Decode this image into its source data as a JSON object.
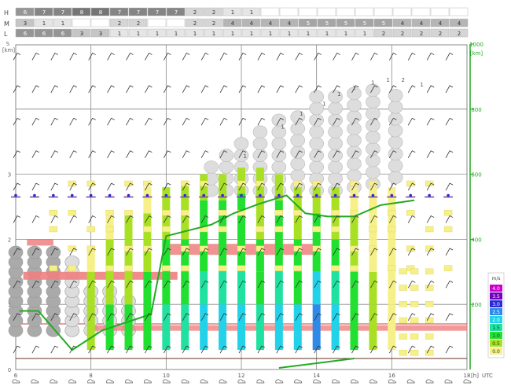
{
  "cloud_rows": [
    {
      "label": "H",
      "cells": [
        "6",
        "7",
        "7",
        "8",
        "8",
        "7",
        "7",
        "7",
        "7",
        "2",
        "2",
        "1",
        "1",
        "",
        "",
        "",
        "",
        "",
        "",
        "",
        "",
        "",
        "",
        ""
      ]
    },
    {
      "label": "M",
      "cells": [
        "3",
        "1",
        "1",
        "",
        "",
        "2",
        "2",
        "",
        "",
        "2",
        "2",
        "4",
        "4",
        "4",
        "4",
        "5",
        "5",
        "5",
        "5",
        "5",
        "4",
        "4",
        "4",
        "4"
      ]
    },
    {
      "label": "L",
      "cells": [
        "6",
        "6",
        "6",
        "3",
        "3",
        "1",
        "1",
        "1",
        "1",
        "1",
        "1",
        "1",
        "1",
        "1",
        "1",
        "1",
        "1",
        "1",
        "1",
        "2",
        "2",
        "2",
        "2",
        "2"
      ]
    }
  ],
  "chart_data": {
    "type": "heatmap",
    "x_unit": "UTC",
    "x_ticks": [
      "6",
      "8",
      "10",
      "12",
      "14",
      "16",
      "18"
    ],
    "x_tick_suffix": "[h]",
    "xlim": [
      6,
      18
    ],
    "y_left_label": "S",
    "y_left_unit": "[km]",
    "y_left_ticks": [
      "0",
      "1",
      "2",
      "3"
    ],
    "ylim_km": [
      0,
      5
    ],
    "y_right_unit": "[km]",
    "y_right_ticks": [
      "200",
      "400",
      "600",
      "800",
      "1000"
    ],
    "legend": {
      "unit": "m/s",
      "entries": [
        {
          "label": "4.0",
          "color": "#cc00cc"
        },
        {
          "label": "3.5",
          "color": "#7000c0"
        },
        {
          "label": "3.0",
          "color": "#2a2ad8"
        },
        {
          "label": "2.5",
          "color": "#2e8ae6"
        },
        {
          "label": "2.0",
          "color": "#22d2e8"
        },
        {
          "label": "1.5",
          "color": "#1fe2a0"
        },
        {
          "label": "1.0",
          "color": "#22e030"
        },
        {
          "label": "0.5",
          "color": "#a8e024"
        },
        {
          "label": "0.0",
          "color": "#f6f088"
        }
      ]
    },
    "boundary_layer_height_right_scale": [
      {
        "t": 6.1,
        "h": 180
      },
      {
        "t": 6.6,
        "h": 180
      },
      {
        "t": 7.2,
        "h": 100
      },
      {
        "t": 7.5,
        "h": 60
      },
      {
        "t": 8.3,
        "h": 120
      },
      {
        "t": 9.6,
        "h": 170
      },
      {
        "t": 10.0,
        "h": 410
      },
      {
        "t": 11.2,
        "h": 445
      },
      {
        "t": 11.8,
        "h": 480
      },
      {
        "t": 12.5,
        "h": 510
      },
      {
        "t": 13.2,
        "h": 535
      },
      {
        "t": 13.7,
        "h": 480
      },
      {
        "t": 14.3,
        "h": 470
      },
      {
        "t": 15.0,
        "h": 470
      },
      {
        "t": 15.7,
        "h": 505
      },
      {
        "t": 16.6,
        "h": 520
      }
    ],
    "cloud_counts": [
      "1",
      "1",
      "1",
      "1",
      "1",
      "1",
      "1",
      "1",
      "2",
      "1"
    ],
    "vertical_velocity_cells": [
      {
        "t": 8.0,
        "z": [
          0.3,
          1.0,
          1.5
        ],
        "v": [
          0.5,
          0.5,
          0.0
        ]
      },
      {
        "t": 8.5,
        "z": [
          0.3,
          1.0,
          1.5,
          2.0
        ],
        "v": [
          1.0,
          0.5,
          0.5,
          0.0
        ]
      },
      {
        "t": 9.0,
        "z": [
          0.3,
          1.0,
          1.5,
          2.0
        ],
        "v": [
          1.0,
          0.5,
          0.5,
          0.5
        ]
      },
      {
        "t": 9.5,
        "z": [
          0.3,
          1.0,
          1.5,
          2.0,
          2.4
        ],
        "v": [
          1.0,
          1.0,
          0.5,
          0.5,
          0.0
        ]
      },
      {
        "t": 10.0,
        "z": [
          0.3,
          1.0,
          1.5,
          2.0,
          2.4
        ],
        "v": [
          1.5,
          1.0,
          1.0,
          0.5,
          0.5
        ]
      },
      {
        "t": 10.5,
        "z": [
          0.3,
          1.0,
          1.5,
          2.0,
          2.5
        ],
        "v": [
          1.5,
          1.0,
          1.0,
          0.5,
          0.5
        ]
      },
      {
        "t": 11.0,
        "z": [
          0.3,
          1.0,
          1.5,
          2.0,
          2.6
        ],
        "v": [
          2.0,
          1.5,
          1.0,
          1.0,
          0.5
        ]
      },
      {
        "t": 11.5,
        "z": [
          0.3,
          1.0,
          1.5,
          2.0,
          2.6
        ],
        "v": [
          2.0,
          1.5,
          1.0,
          1.0,
          0.5
        ]
      },
      {
        "t": 12.0,
        "z": [
          0.3,
          1.0,
          1.5,
          2.0,
          2.7
        ],
        "v": [
          2.0,
          1.5,
          1.0,
          1.0,
          0.5
        ]
      },
      {
        "t": 12.5,
        "z": [
          0.3,
          1.0,
          1.5,
          2.0,
          2.7
        ],
        "v": [
          1.5,
          1.0,
          1.0,
          0.5,
          0.5
        ]
      },
      {
        "t": 13.0,
        "z": [
          0.3,
          1.0,
          1.5,
          2.0,
          2.6
        ],
        "v": [
          2.0,
          1.5,
          1.0,
          1.0,
          0.5
        ]
      },
      {
        "t": 13.5,
        "z": [
          0.3,
          1.0,
          1.5,
          2.0,
          2.4
        ],
        "v": [
          2.0,
          1.0,
          1.0,
          0.5,
          0.5
        ]
      },
      {
        "t": 14.0,
        "z": [
          0.3,
          1.0,
          1.5,
          2.0,
          2.4
        ],
        "v": [
          2.5,
          2.0,
          1.0,
          1.0,
          0.5
        ]
      },
      {
        "t": 14.5,
        "z": [
          0.3,
          1.0,
          1.5,
          2.0,
          2.4
        ],
        "v": [
          2.0,
          1.5,
          1.0,
          0.5,
          0.5
        ]
      },
      {
        "t": 15.0,
        "z": [
          0.3,
          1.0,
          1.5,
          2.0,
          2.4
        ],
        "v": [
          1.0,
          1.0,
          0.5,
          0.5,
          0.0
        ]
      },
      {
        "t": 15.5,
        "z": [
          0.3,
          1.0,
          1.5,
          2.0,
          2.4
        ],
        "v": [
          0.5,
          0.5,
          0.0,
          0.0,
          0.0
        ]
      },
      {
        "t": 16.0,
        "z": [
          0.3,
          1.0,
          1.5,
          2.0,
          2.4
        ],
        "v": [
          0.0,
          0.0,
          0.0,
          0.0,
          0.0
        ]
      }
    ]
  }
}
